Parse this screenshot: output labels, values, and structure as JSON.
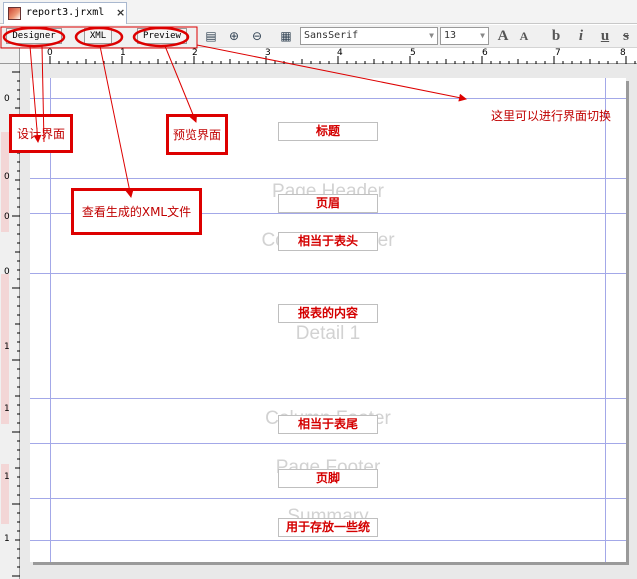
{
  "tab": {
    "title": "report3.jrxml",
    "close": "×"
  },
  "toolbar": {
    "designer_label": "Designer",
    "xml_label": "XML",
    "preview_label": "Preview",
    "font_family": "SansSerif",
    "font_size": "13",
    "bold_label": "b",
    "italic_label": "i",
    "underline_label": "u",
    "strike_label": "s",
    "increase_font_label": "A",
    "decrease_font_label": "A"
  },
  "rulers": {
    "horizontal": [
      "0",
      "1",
      "2",
      "3",
      "4",
      "5",
      "6",
      "7",
      "8"
    ],
    "vertical": [
      "0",
      "0",
      "0",
      "0",
      "1",
      "1",
      "1",
      "1"
    ]
  },
  "report": {
    "fields": {
      "title": "标题",
      "page_header": "页眉",
      "column_header": "相当于表头",
      "detail": "报表的内容",
      "column_footer": "相当于表尾",
      "page_footer": "页脚",
      "summary": "用于存放一些统"
    },
    "bands": {
      "page_header": "Page Header",
      "column_header": "Column Header",
      "detail": "Detail 1",
      "column_footer": "Column Footer",
      "page_footer": "Page Footer",
      "summary": "Summary"
    }
  },
  "annotations": {
    "designer": "设计界面",
    "xml": "查看生成的XML文件",
    "preview": "预览界面",
    "switch": "这里可以进行界面切换"
  },
  "colors": {
    "annotation": "#dd0000",
    "guide": "#a3a8e8",
    "field_text": "#d40000"
  }
}
